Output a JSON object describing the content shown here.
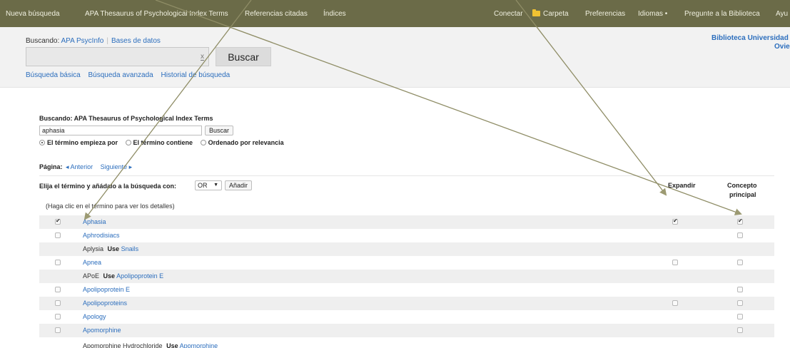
{
  "topnav": {
    "items": [
      "Nueva búsqueda",
      "APA Thesaurus of Psychological Index Terms",
      "Referencias citadas",
      "Índices"
    ],
    "right": [
      "Conectar",
      "Carpeta",
      "Preferencias",
      "Idiomas •",
      "Pregunte a la Biblioteca",
      "Ayu"
    ]
  },
  "search": {
    "label": "Buscando:",
    "database": "APA PsycInfo",
    "databases_link": "Bases de datos",
    "clear": "x",
    "button": "Buscar",
    "links": [
      "Búsqueda básica",
      "Búsqueda avanzada",
      "Historial de búsqueda"
    ]
  },
  "library": {
    "line1": "Biblioteca Universidad",
    "line2": "Ovie"
  },
  "thesaurus": {
    "heading": "Buscando: APA Thesaurus of Psychological Index Terms",
    "query": "aphasia",
    "button": "Buscar",
    "radio": [
      "El término empieza por",
      "El término contiene",
      "Ordenado por relevancia"
    ],
    "page_label": "Página:",
    "prev": "◂ Anterior",
    "next": "Siguiente ▸",
    "choose_label": "Elija el término y añádalo a la búsqueda con:",
    "operator": "OR",
    "add_button": "Añadir",
    "col_expand": "Expandir",
    "col_concept_1": "Concepto",
    "col_concept_2": "principal",
    "hint": "(Haga clic en el término para ver los detalles)",
    "use_word": "Use",
    "rows": [
      {
        "term": "Aphasia"
      },
      {
        "term": "Aphrodisiacs"
      },
      {
        "term": "Aplysia",
        "use": "Snails"
      },
      {
        "term": "Apnea"
      },
      {
        "term": "APoE",
        "use": "Apolipoprotein E"
      },
      {
        "term": "Apolipoprotein E"
      },
      {
        "term": "Apolipoproteins"
      },
      {
        "term": "Apology"
      },
      {
        "term": "Apomorphine"
      },
      {
        "term": "Apomorphine Hydrochloride",
        "use": "Apomorphine"
      }
    ]
  },
  "colors": {
    "topbar": "#6b6b48",
    "link": "#2c6ebd",
    "arrow": "#9c9a72"
  },
  "icons": [
    "folder-icon",
    "checkbox-icon",
    "radio-icon",
    "clear-icon",
    "arrow-annotation"
  ]
}
